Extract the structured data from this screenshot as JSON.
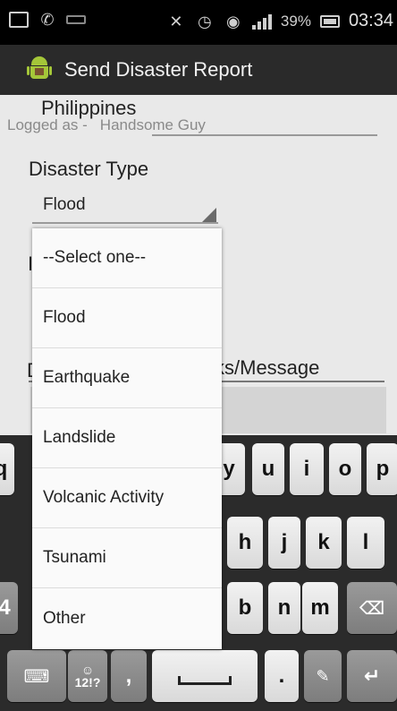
{
  "status_bar": {
    "battery_pct": "39%",
    "time": "03:34",
    "icons": [
      "image-icon",
      "phone-icon",
      "keyboard-icon",
      "mute-icon",
      "alarm-icon",
      "wifi-icon",
      "signal-icon",
      "battery-icon"
    ]
  },
  "title_bar": {
    "title": "Send Disaster Report",
    "icon": "android-app-icon"
  },
  "form": {
    "country": "Philippines",
    "logged_label": "Logged as -",
    "logged_name": "Handsome Guy",
    "disaster_type_label": "Disaster Type",
    "disaster_type_value": "Flood",
    "partial_label_i": "I",
    "partial_label_d": "D",
    "remarks_label": "ks/Message"
  },
  "dropdown": {
    "options": [
      "--Select one--",
      "Flood",
      "Earthquake",
      "Landslide",
      "Volcanic Activity",
      "Tsunami",
      "Other"
    ]
  },
  "keyboard": {
    "row1": [
      "q",
      "y",
      "u",
      "i",
      "o",
      "p"
    ],
    "row2": [
      "h",
      "j",
      "k",
      "l"
    ],
    "row3": [
      "4",
      "b",
      "n",
      "m"
    ],
    "row4": {
      "symbols": "12!?",
      "comma": ",",
      "period": "."
    },
    "icons": [
      "keyboard-settings-icon",
      "emoji-icon",
      "space-icon",
      "voice-settings-icon",
      "backspace-icon",
      "enter-icon"
    ]
  },
  "colors": {
    "title_bar_bg": "#2a2a2a",
    "content_bg": "#e9e9e9",
    "keyboard_bg": "#2b2b2b",
    "android_green": "#a4c639"
  }
}
